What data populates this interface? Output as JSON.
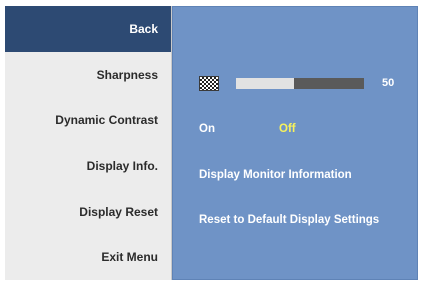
{
  "menu": {
    "items": [
      {
        "label": "Back",
        "active": true
      },
      {
        "label": "Sharpness"
      },
      {
        "label": "Dynamic Contrast"
      },
      {
        "label": "Display Info."
      },
      {
        "label": "Display Reset"
      },
      {
        "label": "Exit Menu"
      }
    ]
  },
  "panel": {
    "sharpness": {
      "icon": "sharpness-pattern-icon",
      "value": "50",
      "level": 0.45
    },
    "dynamic_contrast": {
      "on_label": "On",
      "off_label": "Off",
      "selected": "Off"
    },
    "display_info": {
      "label": "Display Monitor Information"
    },
    "display_reset": {
      "label": "Reset to Default Display Settings"
    }
  },
  "colors": {
    "menu_bg": "#ececec",
    "back_bg": "#2d4a73",
    "panel_bg": "#6f93c6",
    "selected_option": "#f7f25c"
  }
}
